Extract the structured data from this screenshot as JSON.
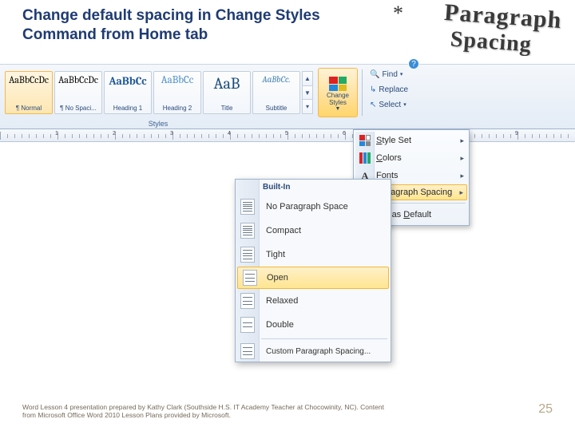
{
  "slide": {
    "title": "Change default spacing in Change Styles Command from Home tab",
    "decor_line1": "Paragraph",
    "decor_line2": "Spacing",
    "star": "*",
    "footer": "Word Lesson 4 presentation prepared by Kathy Clark (Southside H.S. IT Academy Teacher at Chocowinity, NC). Content from Microsoft Office Word 2010 Lesson Plans provided by Microsoft.",
    "page_number": "25"
  },
  "ribbon": {
    "styles_group_label": "Styles",
    "styles": [
      {
        "sample": "AaBbCcDc",
        "label": "¶ Normal"
      },
      {
        "sample": "AaBbCcDc",
        "label": "¶ No Spaci..."
      },
      {
        "sample": "AaBbCc",
        "label": "Heading 1"
      },
      {
        "sample": "AaBbCc",
        "label": "Heading 2"
      },
      {
        "sample": "AaB",
        "label": "Title"
      },
      {
        "sample": "AaBbCc.",
        "label": "Subtitle"
      }
    ],
    "change_styles_label": "Change Styles",
    "editing": {
      "find": "Find",
      "replace": "Replace",
      "select": "Select"
    }
  },
  "change_styles_menu": {
    "style_set": "Style Set",
    "colors": "Colors",
    "fonts": "Fonts",
    "paragraph_spacing": "Paragraph Spacing",
    "set_as_default": "Set as Default"
  },
  "paragraph_spacing_menu": {
    "header": "Built-In",
    "items": [
      "No Paragraph Space",
      "Compact",
      "Tight",
      "Open",
      "Relaxed",
      "Double"
    ],
    "highlighted_index": 3,
    "custom": "Custom Paragraph Spacing..."
  }
}
